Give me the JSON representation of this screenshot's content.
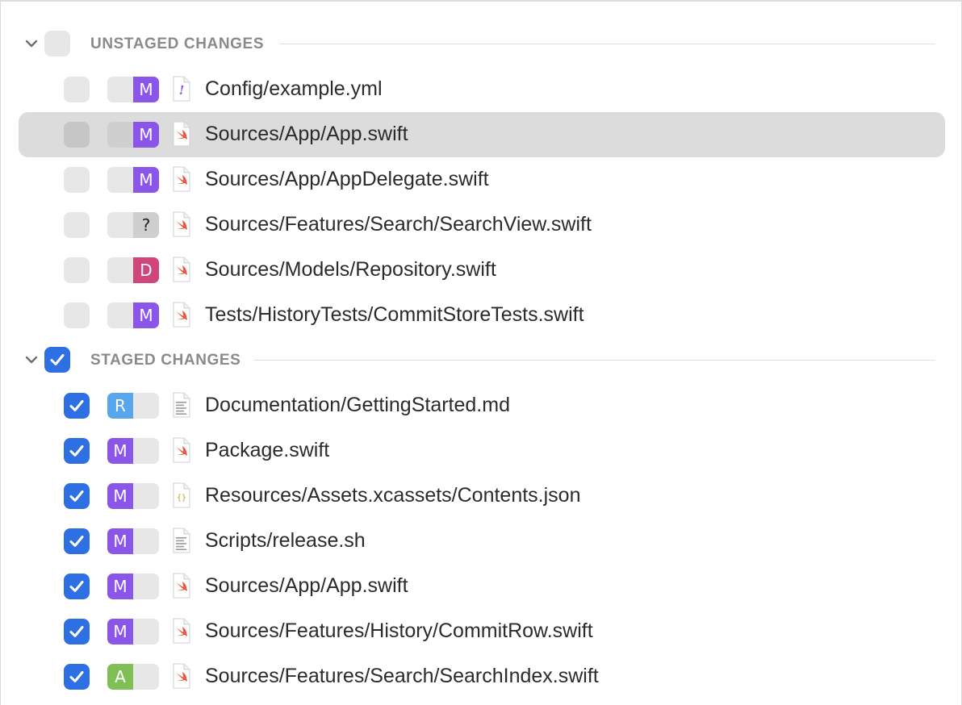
{
  "colors": {
    "modified": "#8a55e8",
    "deleted": "#d1467a",
    "untracked": "#cfcfcf",
    "renamed": "#58a6ec",
    "added": "#7fbf55",
    "checkbox_on": "#2f6fe4",
    "checkbox_off": "#e7e7e7"
  },
  "unstaged": {
    "title": "UNSTAGED CHANGES",
    "checked": false,
    "expanded": true,
    "chevron_icon": "chevron-down-icon",
    "files": [
      {
        "status": "M",
        "status_type": "modified",
        "path": "Config/example.yml",
        "icon": "yaml-file-icon",
        "checked": false,
        "selected": false
      },
      {
        "status": "M",
        "status_type": "modified",
        "path": "Sources/App/App.swift",
        "icon": "swift-file-icon",
        "checked": false,
        "selected": true
      },
      {
        "status": "M",
        "status_type": "modified",
        "path": "Sources/App/AppDelegate.swift",
        "icon": "swift-file-icon",
        "checked": false,
        "selected": false
      },
      {
        "status": "?",
        "status_type": "untracked",
        "path": "Sources/Features/Search/SearchView.swift",
        "icon": "swift-file-icon",
        "checked": false,
        "selected": false
      },
      {
        "status": "D",
        "status_type": "deleted",
        "path": "Sources/Models/Repository.swift",
        "icon": "swift-file-icon",
        "checked": false,
        "selected": false
      },
      {
        "status": "M",
        "status_type": "modified",
        "path": "Tests/HistoryTests/CommitStoreTests.swift",
        "icon": "swift-file-icon",
        "checked": false,
        "selected": false
      }
    ]
  },
  "staged": {
    "title": "STAGED CHANGES",
    "checked": true,
    "expanded": true,
    "chevron_icon": "chevron-down-icon",
    "files": [
      {
        "status": "R",
        "status_type": "renamed",
        "path": "Documentation/GettingStarted.md",
        "icon": "text-file-icon",
        "checked": true,
        "selected": false
      },
      {
        "status": "M",
        "status_type": "modified",
        "path": "Package.swift",
        "icon": "swift-file-icon",
        "checked": true,
        "selected": false
      },
      {
        "status": "M",
        "status_type": "modified",
        "path": "Resources/Assets.xcassets/Contents.json",
        "icon": "json-file-icon",
        "checked": true,
        "selected": false
      },
      {
        "status": "M",
        "status_type": "modified",
        "path": "Scripts/release.sh",
        "icon": "text-file-icon",
        "checked": true,
        "selected": false
      },
      {
        "status": "M",
        "status_type": "modified",
        "path": "Sources/App/App.swift",
        "icon": "swift-file-icon",
        "checked": true,
        "selected": false
      },
      {
        "status": "M",
        "status_type": "modified",
        "path": "Sources/Features/History/CommitRow.swift",
        "icon": "swift-file-icon",
        "checked": true,
        "selected": false
      },
      {
        "status": "A",
        "status_type": "added",
        "path": "Sources/Features/Search/SearchIndex.swift",
        "icon": "swift-file-icon",
        "checked": true,
        "selected": false
      }
    ]
  }
}
